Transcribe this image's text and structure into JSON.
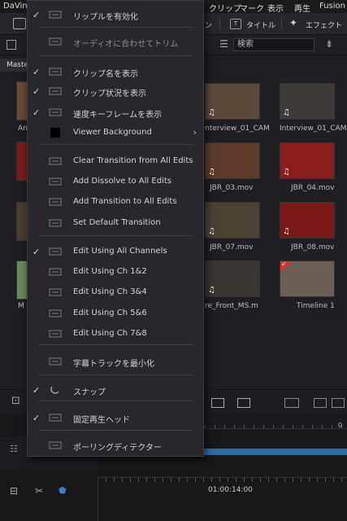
{
  "menubar": {
    "app": "DaVin",
    "items": [
      "クリップ",
      "マーク",
      "表示",
      "再生",
      "Fusion"
    ]
  },
  "toolbar": {
    "left_frag": "ン",
    "title_label": "タイトル",
    "effects_label": "エフェクト",
    "title_key": "T"
  },
  "search": {
    "placeholder": "検索"
  },
  "pool": {
    "tab": "Maste",
    "left_labels": [
      "An",
      "M"
    ],
    "clips": [
      {
        "label": "nterview_01_CAM",
        "tone": "#5a4a3a"
      },
      {
        "label": "Interview_01_CAM",
        "tone": "#3e3a38"
      },
      {
        "label": "JBR_03.mov",
        "tone": "#5d3b2a"
      },
      {
        "label": "JBR_04.mov",
        "tone": "#8a1d1d"
      },
      {
        "label": "JBR_07.mov",
        "tone": "#4a4233"
      },
      {
        "label": "JBR_08.mov",
        "tone": "#7a1818"
      },
      {
        "label": "re_Front_MS.m",
        "tone": "#3a3530"
      },
      {
        "label": "Timeline 1",
        "tone": "#6a5e55"
      }
    ]
  },
  "timeline": {
    "timecode": "01:00:14:00",
    "mini_tc": "0"
  },
  "menu": {
    "items": [
      {
        "label": "リップルを有効化",
        "checked": true,
        "disabled": false,
        "icon": "ripple-icon"
      },
      {
        "label": "オーディオに合わせてトリム",
        "checked": false,
        "disabled": true,
        "icon": "audio-trim-icon"
      },
      {
        "label": "クリップ名を表示",
        "checked": true,
        "disabled": false,
        "icon": "clip-name-icon"
      },
      {
        "label": "クリップ状況を表示",
        "checked": true,
        "disabled": false,
        "icon": "clip-status-icon"
      },
      {
        "label": "速度キーフレームを表示",
        "checked": true,
        "disabled": false,
        "icon": "speed-keyframe-icon"
      },
      {
        "label": "Viewer Background",
        "checked": false,
        "disabled": false,
        "icon": "viewer-bg-icon",
        "submenu": true
      },
      {
        "label": "Clear Transition from All Edits",
        "checked": false,
        "disabled": false,
        "icon": "clear-transition-icon"
      },
      {
        "label": "Add Dissolve to All Edits",
        "checked": false,
        "disabled": false,
        "icon": "dissolve-icon"
      },
      {
        "label": "Add Transition to All Edits",
        "checked": false,
        "disabled": false,
        "icon": "add-transition-icon"
      },
      {
        "label": "Set Default Transition",
        "checked": false,
        "disabled": false,
        "icon": "default-transition-icon"
      },
      {
        "label": "Edit Using All Channels",
        "checked": true,
        "disabled": false,
        "icon": "channels-all-icon"
      },
      {
        "label": "Edit Using Ch 1&2",
        "checked": false,
        "disabled": false,
        "icon": "channels-12-icon"
      },
      {
        "label": "Edit Using Ch 3&4",
        "checked": false,
        "disabled": false,
        "icon": "channels-34-icon"
      },
      {
        "label": "Edit Using Ch 5&6",
        "checked": false,
        "disabled": false,
        "icon": "channels-56-icon"
      },
      {
        "label": "Edit Using Ch 7&8",
        "checked": false,
        "disabled": false,
        "icon": "channels-78-icon"
      },
      {
        "label": "字幕トラックを最小化",
        "checked": false,
        "disabled": false,
        "icon": "subtitle-track-icon"
      },
      {
        "label": "スナップ",
        "checked": true,
        "disabled": false,
        "icon": "snap-icon"
      },
      {
        "label": "固定再生ヘッド",
        "checked": true,
        "disabled": false,
        "icon": "fixed-playhead-icon"
      },
      {
        "label": "ポーリングディテクター",
        "checked": false,
        "disabled": false,
        "icon": "polling-detector-icon"
      }
    ]
  }
}
